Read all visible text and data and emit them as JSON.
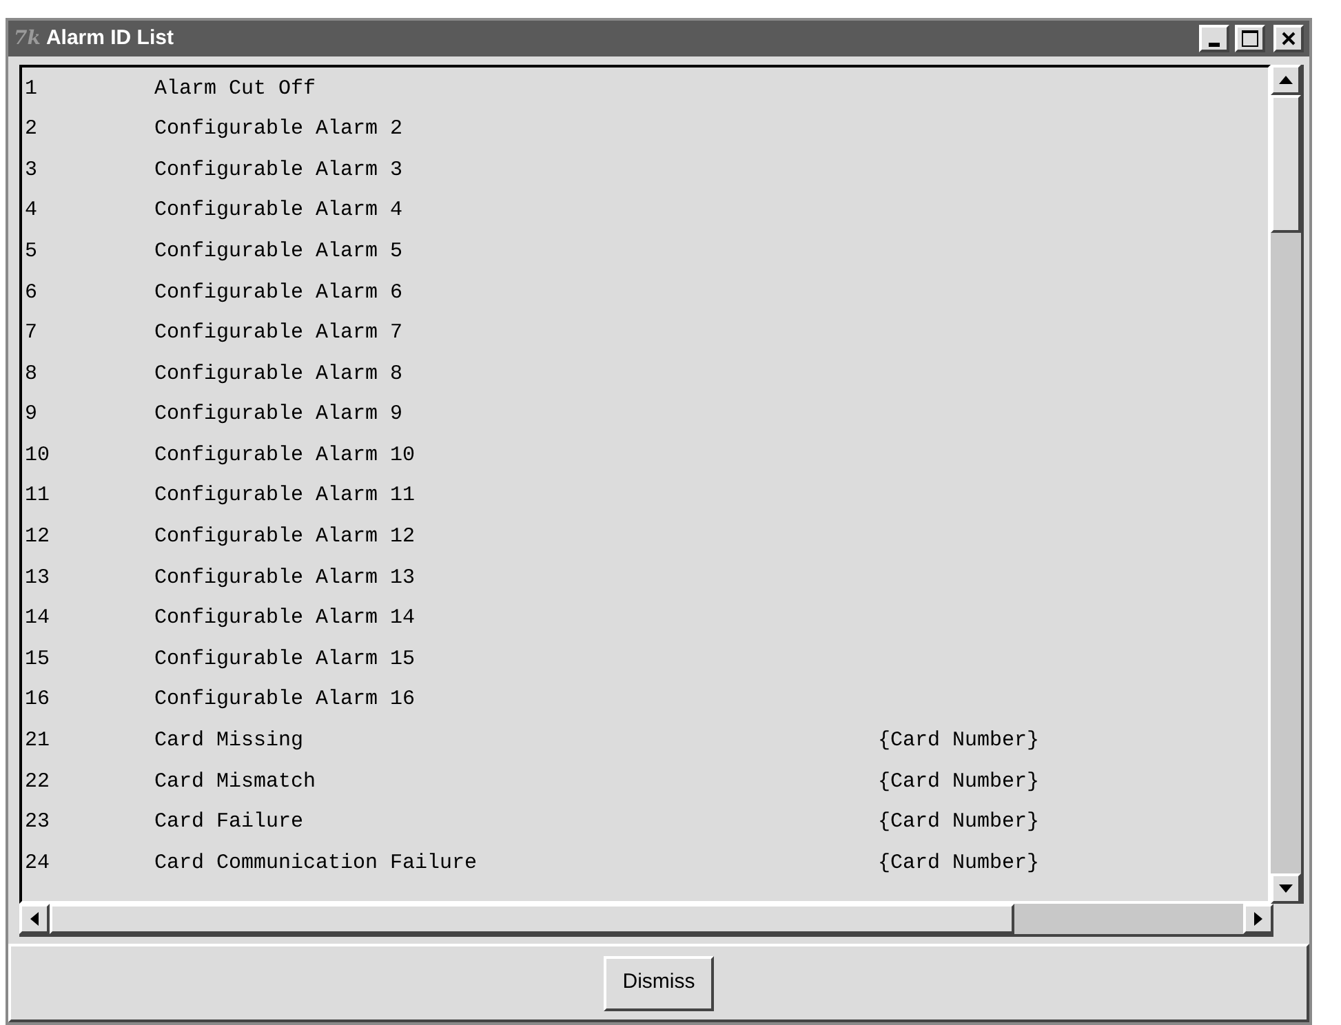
{
  "window": {
    "title": "Alarm ID List",
    "icon": "7k"
  },
  "rows": [
    {
      "id": "1",
      "name": "Alarm Cut Off"
    },
    {
      "id": "2",
      "name": "Configurable Alarm 2"
    },
    {
      "id": "3",
      "name": "Configurable Alarm 3"
    },
    {
      "id": "4",
      "name": "Configurable Alarm 4"
    },
    {
      "id": "5",
      "name": "Configurable Alarm 5"
    },
    {
      "id": "6",
      "name": "Configurable Alarm 6"
    },
    {
      "id": "7",
      "name": "Configurable Alarm 7"
    },
    {
      "id": "8",
      "name": "Configurable Alarm 8"
    },
    {
      "id": "9",
      "name": "Configurable Alarm 9"
    },
    {
      "id": "10",
      "name": "Configurable Alarm 10"
    },
    {
      "id": "11",
      "name": "Configurable Alarm 11"
    },
    {
      "id": "12",
      "name": "Configurable Alarm 12"
    },
    {
      "id": "13",
      "name": "Configurable Alarm 13"
    },
    {
      "id": "14",
      "name": "Configurable Alarm 14"
    },
    {
      "id": "15",
      "name": "Configurable Alarm 15"
    },
    {
      "id": "16",
      "name": "Configurable Alarm 16"
    },
    {
      "id": "21",
      "name": "Card Missing",
      "parameter": "{Card Number}"
    },
    {
      "id": "22",
      "name": "Card Mismatch",
      "parameter": "{Card Number}"
    },
    {
      "id": "23",
      "name": "Card Failure",
      "parameter": "{Card Number}"
    },
    {
      "id": "24",
      "name": "Card Communication Failure",
      "parameter": "{Card Number}"
    }
  ],
  "buttons": [
    "Dismiss"
  ]
}
